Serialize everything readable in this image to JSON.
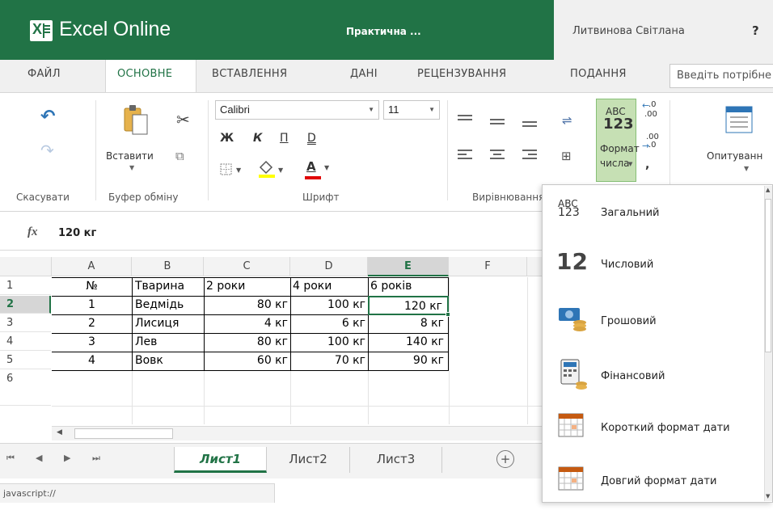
{
  "app": {
    "name": "Excel Online",
    "document": "Практична ...",
    "user": "Литвинова Світлана",
    "help": "?"
  },
  "tabs": [
    "ФАЙЛ",
    "ОСНОВНЕ",
    "ВСТАВЛЕННЯ",
    "ДАНІ",
    "РЕЦЕНЗУВАННЯ",
    "ПОДАННЯ"
  ],
  "active_tab": "ОСНОВНЕ",
  "tell_me_placeholder": "Введіть потрібне",
  "ribbon": {
    "groups": {
      "undo": "Скасувати",
      "clipboard": "Буфер обміну",
      "font": "Шрифт",
      "alignment": "Вирівнювання"
    },
    "paste_label": "Вставити",
    "font_name": "Calibri",
    "font_size": "11",
    "bold": "Ж",
    "italic": "К",
    "underline": "П",
    "double_underline": "D",
    "font_color_letter": "A",
    "number_format_icon_top": "ABC",
    "number_format_icon_bottom": "123",
    "number_format_label_1": "Формат",
    "number_format_label_2": "числа",
    "inc_decimal_top": ".0",
    "inc_decimal_bottom": ".00",
    "dec_decimal_top": ".00",
    "dec_decimal_bottom": ".0",
    "comma": ",",
    "survey_label": "Опитуванн"
  },
  "formula_bar": {
    "fx": "fx",
    "value": "120 кг"
  },
  "columns": [
    "A",
    "B",
    "C",
    "D",
    "E",
    "F"
  ],
  "selected_column": "E",
  "rows": [
    {
      "n": "1",
      "cells": [
        "№",
        "Тварина",
        "2 роки",
        "4 роки",
        "6 років",
        ""
      ]
    },
    {
      "n": "2",
      "cells": [
        "1",
        "Ведмідь",
        "80 кг",
        "100 кг",
        "120 кг",
        ""
      ]
    },
    {
      "n": "3",
      "cells": [
        "2",
        "Лисиця",
        "4 кг",
        "6 кг",
        "8 кг",
        ""
      ]
    },
    {
      "n": "4",
      "cells": [
        "3",
        "Лев",
        "80 кг",
        "100 кг",
        "140 кг",
        ""
      ]
    },
    {
      "n": "5",
      "cells": [
        "4",
        "Вовк",
        "60 кг",
        "70 кг",
        "90 кг",
        ""
      ]
    },
    {
      "n": "6",
      "cells": [
        "",
        "",
        "",
        "",
        "",
        ""
      ]
    }
  ],
  "selected_row": "2",
  "sheets": [
    "Лист1",
    "Лист2",
    "Лист3"
  ],
  "active_sheet": "Лист1",
  "add_sheet": "+",
  "status": "javascript://",
  "number_formats": [
    {
      "label": "Загальний",
      "icon": "abc-123-icon",
      "icon_text_top": "ABC",
      "icon_text_bottom": "123"
    },
    {
      "label": "Числовий",
      "icon": "number-12-icon",
      "icon_text_top": "12"
    },
    {
      "label": "Грошовий",
      "icon": "money-icon"
    },
    {
      "label": "Фінансовий",
      "icon": "calculator-icon"
    },
    {
      "label": "Короткий формат дати",
      "icon": "short-date-calendar-icon"
    },
    {
      "label": "Довгий формат дати",
      "icon": "long-date-calendar-icon"
    }
  ],
  "colors": {
    "brand": "#217346",
    "selection": "#217346",
    "number_format_button": "#c6e0b4"
  }
}
